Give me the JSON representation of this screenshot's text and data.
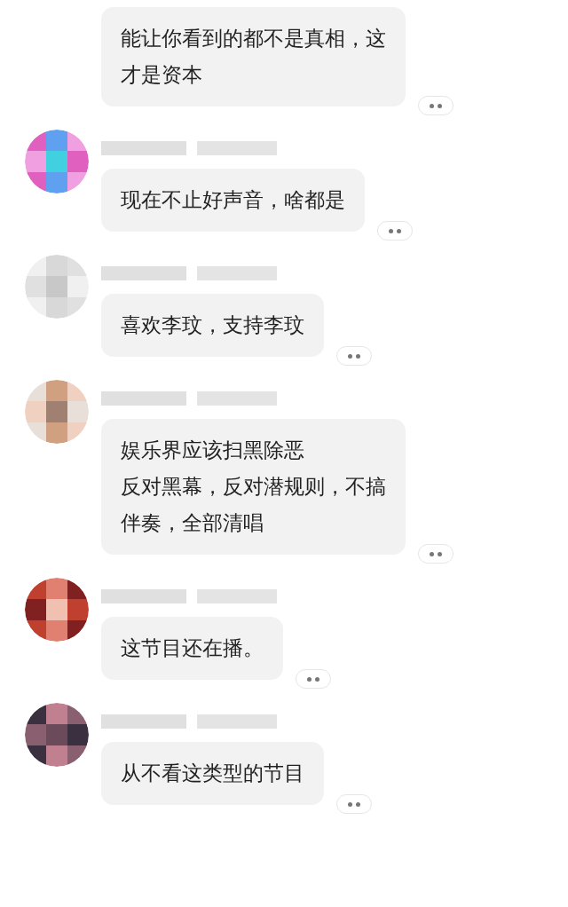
{
  "comments": [
    {
      "has_header": false,
      "lines": [
        "能让你看到的都不是真相，这",
        "才是资本"
      ]
    },
    {
      "has_header": true,
      "lines": [
        "现在不止好声音，啥都是"
      ]
    },
    {
      "has_header": true,
      "lines": [
        "喜欢李玟，支持李玟"
      ]
    },
    {
      "has_header": true,
      "lines": [
        "娱乐界应该扫黑除恶",
        "反对黑幕，反对潜规则，不搞",
        "伴奏，全部清唱"
      ]
    },
    {
      "has_header": true,
      "lines": [
        "这节目还在播。"
      ]
    },
    {
      "has_header": true,
      "lines": [
        "从不看这类型的节目"
      ]
    }
  ]
}
